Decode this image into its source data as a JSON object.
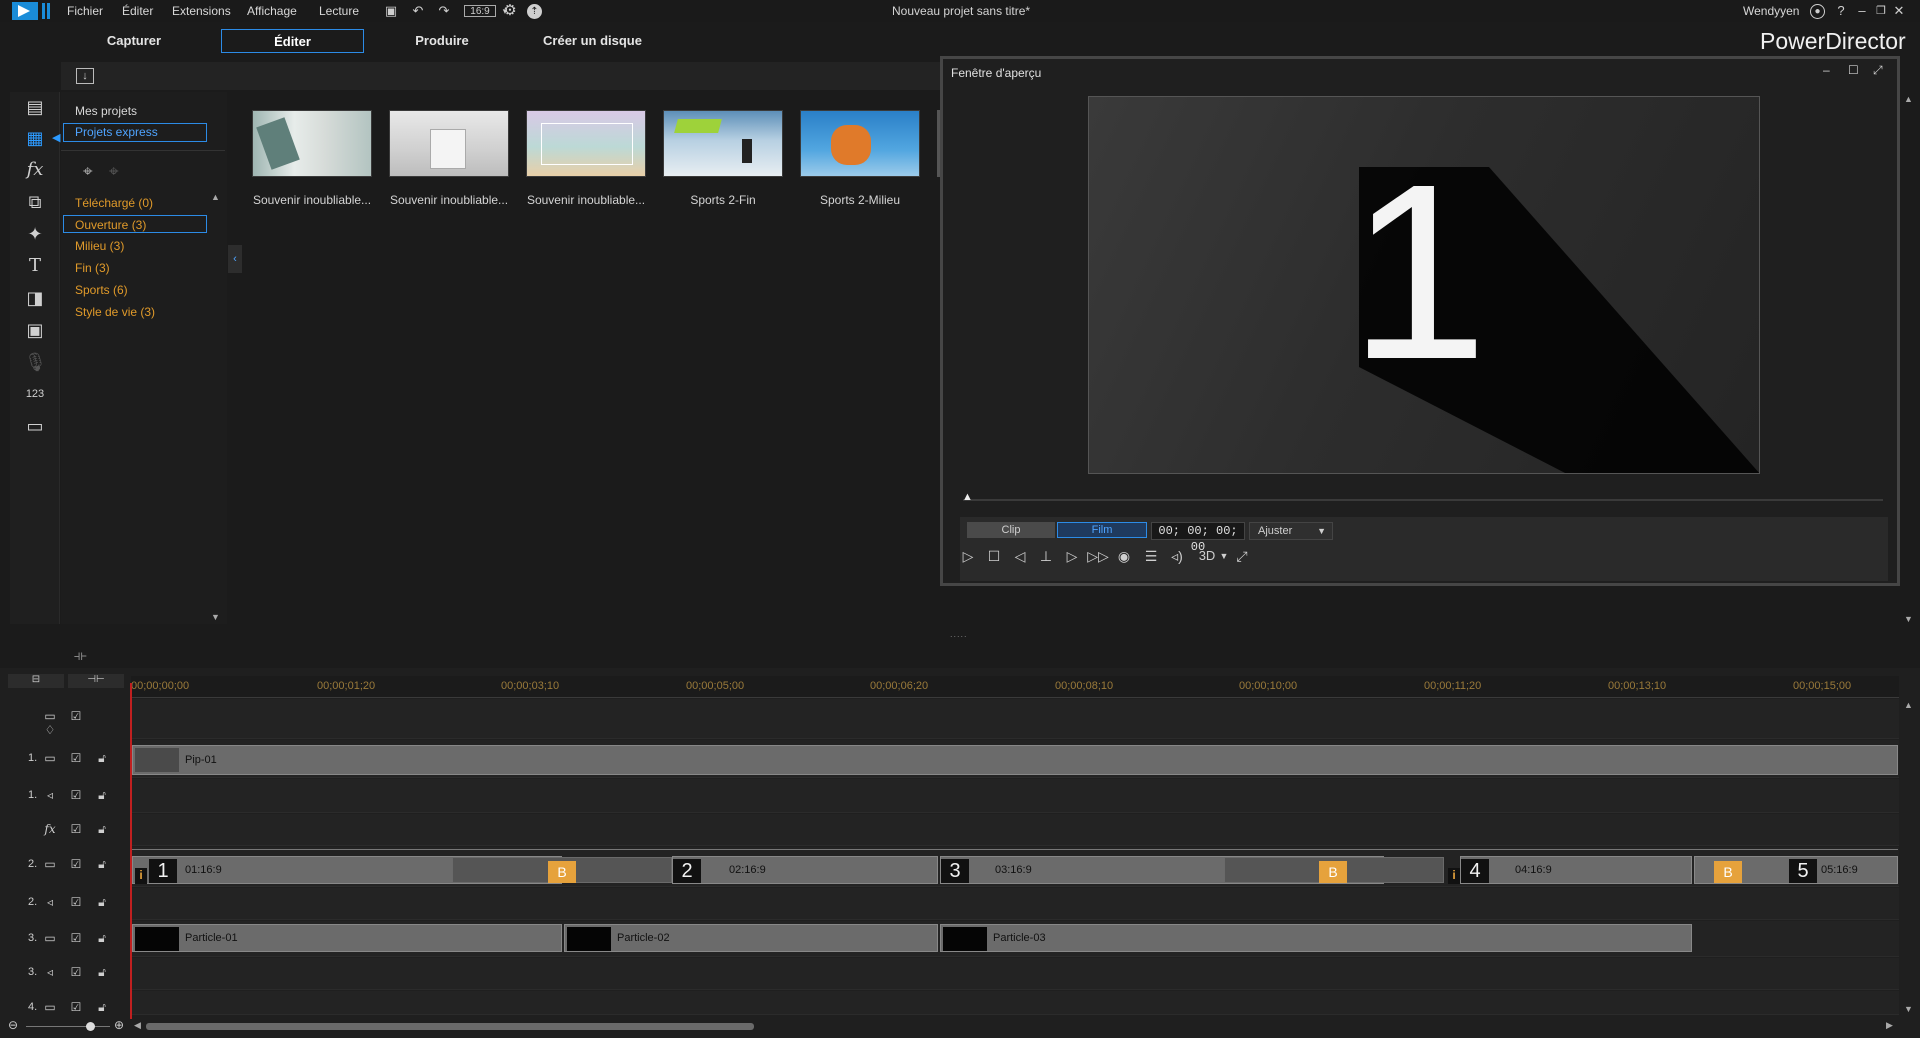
{
  "menu": [
    "Fichier",
    "Éditer",
    "Extensions",
    "Affichage",
    "Lecture"
  ],
  "aspect_ratio": "16:9",
  "window_title": "Nouveau projet sans titre*",
  "user": "Wendyyen",
  "app_name": "PowerDirector",
  "modes": [
    "Capturer",
    "Éditer",
    "Produire",
    "Créer un disque"
  ],
  "active_mode": "Éditer",
  "project_nav": [
    "Mes projets",
    "Projets express"
  ],
  "categories": [
    "Téléchargé  (0)",
    "Ouverture  (3)",
    "Milieu  (3)",
    "Fin  (3)",
    "Sports  (6)",
    "Style de vie  (3)"
  ],
  "selected_category": "Ouverture  (3)",
  "templates": [
    "Souvenir inoubliable...",
    "Souvenir inoubliable...",
    "Souvenir inoubliable...",
    "Sports 2-Fin",
    "Sports 2-Milieu"
  ],
  "preview": {
    "title": "Fenêtre d'aperçu",
    "big_number": "1",
    "mode_clip": "Clip",
    "mode_film": "Film",
    "timecode": "00; 00; 00; 00",
    "fit": "Ajuster",
    "three_d": "3D"
  },
  "ruler": [
    "00;00;00;00",
    "00;00;01;20",
    "00;00;03;10",
    "00;00;05;00",
    "00;00;06;20",
    "00;00;08;10",
    "00;00;10;00",
    "00;00;11;20",
    "00;00;13;10",
    "00;00;15;00"
  ],
  "tracks": {
    "t1_num": "1.",
    "t1a_num": "1.",
    "t2_num": "2.",
    "t2a_num": "2.",
    "t3_num": "3.",
    "t3a_num": "3.",
    "t4_num": "4.",
    "fx": "fx"
  },
  "clips": {
    "pip": "Pip-01",
    "video2": [
      {
        "num": "1",
        "label": "01:16:9"
      },
      {
        "num": "2",
        "label": "02:16:9"
      },
      {
        "num": "3",
        "label": "03:16:9"
      },
      {
        "num": "4",
        "label": "04:16:9"
      },
      {
        "num": "5",
        "label": "05:16:9"
      }
    ],
    "b": "B",
    "info": "i",
    "particles": [
      "Particle-01",
      "Particle-02",
      "Particle-03"
    ]
  },
  "icons": {
    "undo": "undo-icon",
    "redo": "redo-icon",
    "save": "save-icon",
    "settings": "gear-icon",
    "help": "help-icon",
    "play": "play-icon",
    "stop": "stop-icon"
  }
}
